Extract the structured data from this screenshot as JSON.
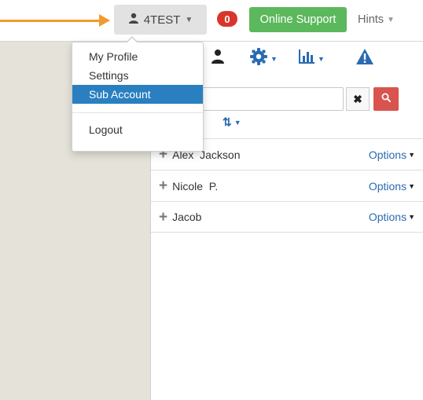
{
  "header": {
    "user_label": "4TEST",
    "notifications_count": "0",
    "support_label": "Online Support",
    "hints_label": "Hints"
  },
  "user_menu": {
    "items": [
      "My Profile",
      "Settings",
      "Sub Account",
      "Logout"
    ],
    "selected": "Sub Account"
  },
  "search": {
    "value": "",
    "clear_label": "✖"
  },
  "list": {
    "rows": [
      {
        "name": "Alex  Jackson",
        "options_label": "Options"
      },
      {
        "name": "Nicole  P.",
        "options_label": "Options"
      },
      {
        "name": "Jacob",
        "options_label": "Options"
      }
    ]
  },
  "icons": [
    "user-icon",
    "gear-icon",
    "bar-chart-icon",
    "warning-icon",
    "search-icon",
    "sort-icon",
    "plus-icon",
    "caret-down-icon"
  ],
  "colors": {
    "support_green": "#5cb85c",
    "badge_red": "#d9362b",
    "menu_active_blue": "#2a7fc0",
    "link_blue": "#2a6bb0",
    "callout_orange": "#f19a2e",
    "sidebar_beige": "#e5e3d9"
  }
}
